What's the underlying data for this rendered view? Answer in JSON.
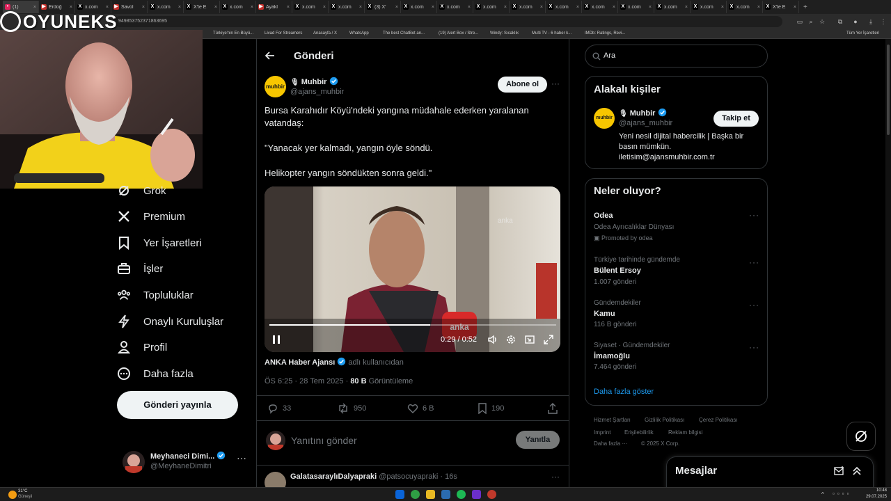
{
  "browser": {
    "tabs": [
      {
        "label": "(1)",
        "color": "#e0245e",
        "fav": "•"
      },
      {
        "label": "Erdoğ",
        "color": "#c4302b",
        "fav": "▶"
      },
      {
        "label": "x.com",
        "color": "#000000",
        "fav": "X"
      },
      {
        "label": "Savol",
        "color": "#c4302b",
        "fav": "▶"
      },
      {
        "label": "x.com",
        "color": "#000000",
        "fav": "X"
      },
      {
        "label": "X'te E",
        "color": "#000000",
        "fav": "X"
      },
      {
        "label": "x.com",
        "color": "#000000",
        "fav": "X"
      },
      {
        "label": "Ayakl",
        "color": "#c4302b",
        "fav": "▶"
      },
      {
        "label": "x.com",
        "color": "#000000",
        "fav": "X"
      },
      {
        "label": "x.com",
        "color": "#000000",
        "fav": "X"
      },
      {
        "label": "(3) X'",
        "color": "#000000",
        "fav": "X"
      },
      {
        "label": "x.com",
        "color": "#000000",
        "fav": "X"
      },
      {
        "label": "x.com",
        "color": "#000000",
        "fav": "X"
      },
      {
        "label": "x.com",
        "color": "#000000",
        "fav": "X"
      },
      {
        "label": "x.com",
        "color": "#000000",
        "fav": "X"
      },
      {
        "label": "x.com",
        "color": "#000000",
        "fav": "X"
      },
      {
        "label": "x.com",
        "color": "#000000",
        "fav": "X"
      },
      {
        "label": "x.com",
        "color": "#000000",
        "fav": "X"
      },
      {
        "label": "x.com",
        "color": "#000000",
        "fav": "X"
      },
      {
        "label": "x.com",
        "color": "#000000",
        "fav": "X"
      },
      {
        "label": "x.com",
        "color": "#000000",
        "fav": "X"
      },
      {
        "label": "X'te E",
        "color": "#000000",
        "fav": "X"
      }
    ],
    "address_fragment": "9498537523718636​95",
    "bookmarks": [
      "Türkiye'nin En Büyü...",
      "Livad For Streamers",
      "Anasayfa / X",
      "WhatsApp",
      "The best ChatBot an...",
      "(19) Alert Box / Stre...",
      "Windy: Sıcaklık",
      "Multi TV - 6 haber k...",
      "IMDb: Ratings, Revi...",
      "Tüm Yer İşaretleri"
    ]
  },
  "overlay": {
    "logo_text": "OYUNEKS"
  },
  "nav": {
    "items": [
      {
        "label": "Grok",
        "icon": "grok-icon"
      },
      {
        "label": "Premium",
        "icon": "x-icon"
      },
      {
        "label": "Yer İşaretleri",
        "icon": "bookmark-icon"
      },
      {
        "label": "İşler",
        "icon": "briefcase-icon"
      },
      {
        "label": "Topluluklar",
        "icon": "communities-icon"
      },
      {
        "label": "Onaylı Kuruluşlar",
        "icon": "lightning-icon"
      },
      {
        "label": "Profil",
        "icon": "person-icon"
      },
      {
        "label": "Daha fazla",
        "icon": "more-circle-icon"
      }
    ],
    "post_button": "Gönderi yayınla",
    "account": {
      "name": "Meyhaneci Dimi...",
      "handle": "@MeyhaneDimitri"
    }
  },
  "post": {
    "header_title": "Gönderi",
    "author_name": "Muhbir",
    "author_handle": "@ajans_muhbir",
    "avatar_text": "muhbir",
    "subscribe_label": "Abone ol",
    "text_p1": "Bursa Karahıdır Köyü'ndeki yangına müdahale ederken yaralanan vatandaş:",
    "text_p2": "\"Yanacak yer kalmadı, yangın öyle söndü.",
    "text_p3": "Helikopter yangın söndükten sonra geldi.\"",
    "video": {
      "time": "0:29 / 0:52",
      "watermark": "anka",
      "progress": 0.56
    },
    "attribution_name": "ANKA Haber Ajansı",
    "attribution_suffix": "adlı kullanıcıdan",
    "timestamp": "ÖS 6:25 · 28 Tem 2025 · ",
    "views_count": "80 B",
    "views_label": "Görüntüleme",
    "stats": {
      "replies": "33",
      "reposts": "950",
      "likes": "6 B",
      "bookmarks": "190"
    },
    "reply_placeholder": "Yanıtını gönder",
    "reply_button": "Yanıtla",
    "next_reply": {
      "name": "GalatasaraylıDalyapraki",
      "handle": "@patsocuyapraki · 16s"
    }
  },
  "sidebar": {
    "search_placeholder": "Ara",
    "relevant": {
      "title": "Alakalı kişiler",
      "name": "Muhbir",
      "handle": "@ajans_muhbir",
      "follow": "Takip et",
      "bio": "Yeni nesil dijital habercilik | Başka bir basın mümkün. iletisim@ajansmuhbir.com.tr"
    },
    "happening": {
      "title": "Neler oluyor?",
      "items": [
        {
          "meta": "",
          "title": "Odea",
          "sub": "Odea Ayrıcalıklar Dünyası",
          "extra": "Promoted by odea"
        },
        {
          "meta": "Türkiye tarihinde gündemde",
          "title": "Bülent Ersoy",
          "sub": "1.007 gönderi"
        },
        {
          "meta": "Gündemdekiler",
          "title": "Kamu",
          "sub": "116 B gönderi"
        },
        {
          "meta": "Siyaset · Gündemdekiler",
          "title": "İmamoğlu",
          "sub": "7.464 gönderi"
        }
      ],
      "show_more": "Daha fazla göster"
    },
    "footer": {
      "line1": [
        "Hizmet Şartları",
        "Gizlilik Politikası",
        "Çerez Politikası"
      ],
      "line2": [
        "Imprint",
        "Erişilebilirlik",
        "Reklam bilgisi"
      ],
      "line3": [
        "Daha fazla ···",
        "© 2025 X Corp."
      ]
    },
    "messages_title": "Mesajlar"
  },
  "taskbar": {
    "weather_temp": "31°C",
    "weather_desc": "Güneşli",
    "time": "10:48",
    "date": "29.07.2025"
  },
  "colors": {
    "accent": "#1d9bf0",
    "bg": "#000000",
    "muted": "#71767b",
    "border": "#2f3336"
  }
}
